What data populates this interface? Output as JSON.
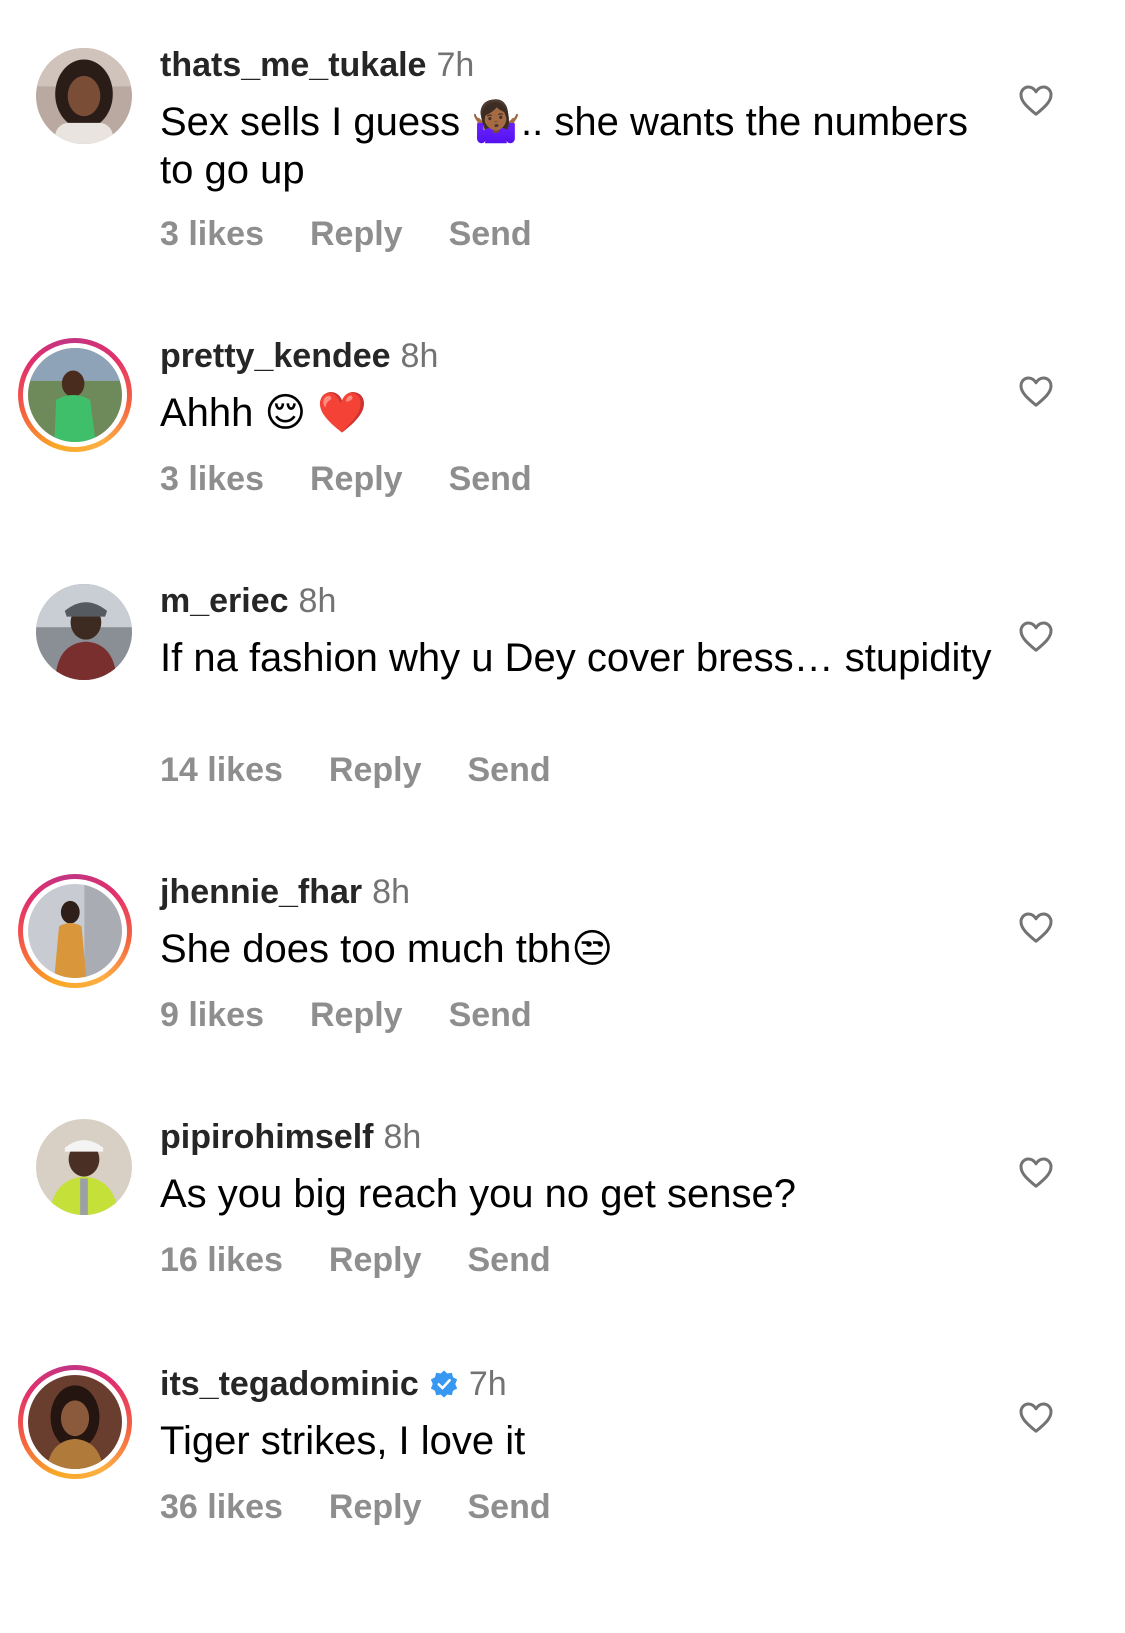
{
  "colors": {
    "username": "#262626",
    "meta": "#737373",
    "actions": "#8e8e8e",
    "verified": "#3897f0"
  },
  "comments": [
    {
      "username": "thats_me_tukale",
      "time": "7h",
      "text": "Sex sells I guess 🤷🏾‍♀️.. she wants the numbers to go up",
      "likes": "3 likes",
      "reply": "Reply",
      "send": "Send",
      "story_ring": false,
      "verified": false
    },
    {
      "username": "pretty_kendee",
      "time": "8h",
      "text": "Ahhh 😌 ❤️",
      "likes": "3 likes",
      "reply": "Reply",
      "send": "Send",
      "story_ring": true,
      "verified": false
    },
    {
      "username": "m_eriec",
      "time": "8h",
      "text": "If na fashion why u Dey cover bress… stupidity",
      "likes": "14 likes",
      "reply": "Reply",
      "send": "Send",
      "story_ring": false,
      "verified": false
    },
    {
      "username": "jhennie_fhar",
      "time": "8h",
      "text": "She does too much tbh😒",
      "likes": "9 likes",
      "reply": "Reply",
      "send": "Send",
      "story_ring": true,
      "verified": false
    },
    {
      "username": "pipirohimself",
      "time": "8h",
      "text": "As you big reach you no get sense?",
      "likes": "16 likes",
      "reply": "Reply",
      "send": "Send",
      "story_ring": false,
      "verified": false
    },
    {
      "username": "its_tegadominic",
      "time": "7h",
      "text": "Tiger strikes, I love it",
      "likes": "36 likes",
      "reply": "Reply",
      "send": "Send",
      "story_ring": true,
      "verified": true
    }
  ]
}
